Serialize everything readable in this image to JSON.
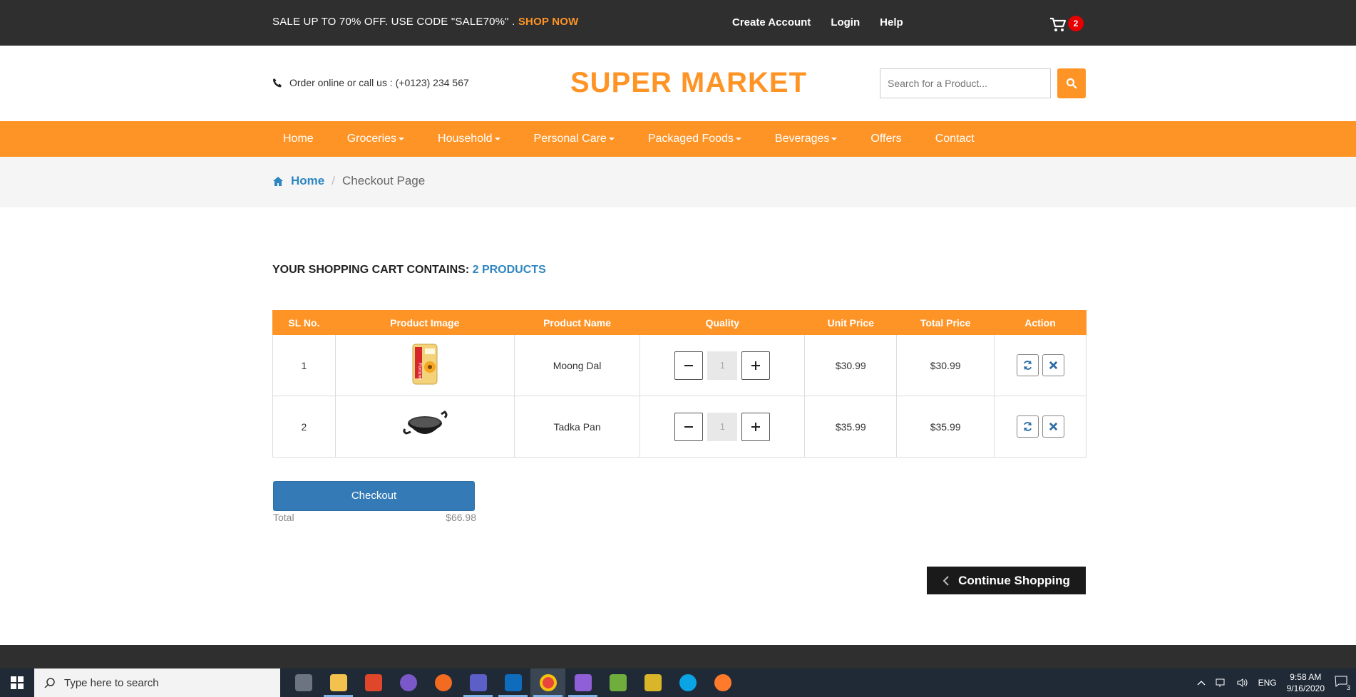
{
  "topbar": {
    "promo_text": "SALE UP TO 70% OFF. USE CODE \"SALE70%\" .",
    "promo_link": "SHOP NOW",
    "links": [
      "Create Account",
      "Login",
      "Help"
    ],
    "cart_count": "2"
  },
  "header": {
    "phone_text": "Order online or call us : (+0123) 234 567",
    "logo": "SUPER MARKET",
    "search_placeholder": "Search for a Product..."
  },
  "nav": {
    "items": [
      {
        "label": "Home",
        "dropdown": false
      },
      {
        "label": "Groceries",
        "dropdown": true
      },
      {
        "label": "Household",
        "dropdown": true
      },
      {
        "label": "Personal Care",
        "dropdown": true
      },
      {
        "label": "Packaged Foods",
        "dropdown": true
      },
      {
        "label": "Beverages",
        "dropdown": true
      },
      {
        "label": "Offers",
        "dropdown": false
      },
      {
        "label": "Contact",
        "dropdown": false
      }
    ]
  },
  "breadcrumb": {
    "home": "Home",
    "separator": "/",
    "current": "Checkout Page"
  },
  "cart": {
    "heading": "YOUR SHOPPING CART CONTAINS:",
    "count_text": "2 PRODUCTS",
    "columns": [
      "SL No.",
      "Product Image",
      "Product Name",
      "Quality",
      "Unit Price",
      "Total Price",
      "Action"
    ],
    "rows": [
      {
        "sl": "1",
        "image": "oil-packet",
        "name": "Moong Dal",
        "qty": "1",
        "unit_price": "$30.99",
        "total_price": "$30.99"
      },
      {
        "sl": "2",
        "image": "kadhai-pan",
        "name": "Tadka Pan",
        "qty": "1",
        "unit_price": "$35.99",
        "total_price": "$35.99"
      }
    ],
    "checkout_label": "Checkout",
    "total_label": "Total",
    "total_value": "$66.98",
    "continue_label": "Continue Shopping"
  },
  "taskbar": {
    "search_placeholder": "Type here to search",
    "language": "ENG",
    "time": "9:58 AM",
    "date": "9/16/2020",
    "notification_count": "3"
  },
  "colors": {
    "accent": "#ff9426",
    "link": "#2e86c1",
    "primary_button": "#337ab7",
    "dark": "#2f2f2f"
  }
}
